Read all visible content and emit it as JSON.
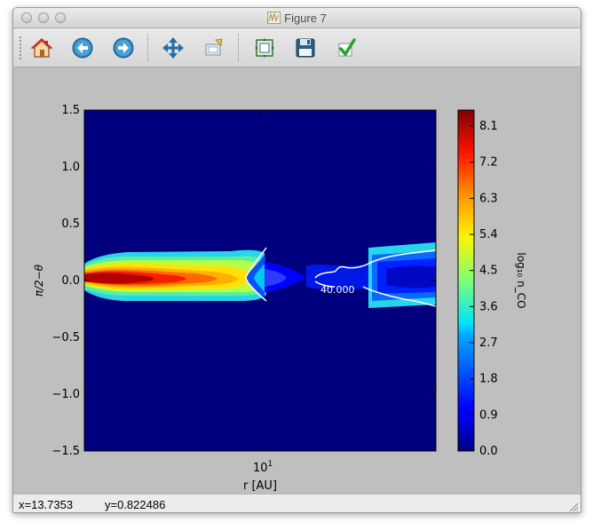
{
  "window": {
    "title": "Figure 7"
  },
  "toolbar": {
    "buttons": [
      {
        "id": "home",
        "icon": "home-icon"
      },
      {
        "id": "back",
        "icon": "back-arrow-icon"
      },
      {
        "id": "forward",
        "icon": "forward-arrow-icon"
      },
      {
        "id": "pan",
        "icon": "move-arrows-icon"
      },
      {
        "id": "zoom",
        "icon": "zoom-rect-icon"
      },
      {
        "id": "subplots",
        "icon": "subplots-config-icon"
      },
      {
        "id": "save",
        "icon": "floppy-disk-icon"
      },
      {
        "id": "edit",
        "icon": "checkmark-icon"
      }
    ]
  },
  "status": {
    "x": "x=13.7353",
    "y": "y=0.822486"
  },
  "chart_data": {
    "type": "heatmap",
    "title": "",
    "xlabel": "r [AU]",
    "ylabel": "π/2−θ",
    "x_scale": "log",
    "x_ticks": [
      "10¹"
    ],
    "y_ticks": [
      "1.5",
      "1.0",
      "0.5",
      "0.0",
      "−0.5",
      "−1.0",
      "−1.5"
    ],
    "ylim": [
      -1.5,
      1.5
    ],
    "colorbar": {
      "label": "log₁₀ n_CO",
      "ticks": [
        "8.1",
        "7.2",
        "6.3",
        "5.4",
        "4.5",
        "3.6",
        "2.7",
        "1.8",
        "0.9",
        "0.0"
      ],
      "range": [
        0.0,
        8.5
      ]
    },
    "contour_label": "40.000",
    "colors": {
      "background": "#00007f",
      "frame": "#bfbfbf"
    }
  }
}
